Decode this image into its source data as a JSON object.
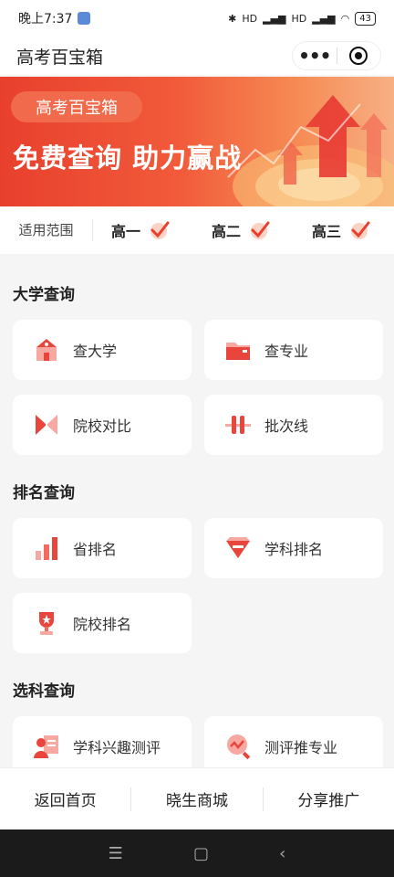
{
  "status": {
    "time": "晚上7:37",
    "battery": "43",
    "net1": "HD",
    "net2": "HD"
  },
  "nav": {
    "title": "高考百宝箱"
  },
  "banner": {
    "tag": "高考百宝箱",
    "headline": "免费查询 助力赢战"
  },
  "scope": {
    "label": "适用范围",
    "grades": [
      "高一",
      "高二",
      "高三"
    ]
  },
  "sections": {
    "university": {
      "title": "大学查询",
      "items": [
        "查大学",
        "查专业",
        "院校对比",
        "批次线"
      ]
    },
    "ranking": {
      "title": "排名查询",
      "items": [
        "省排名",
        "学科排名",
        "院校排名"
      ]
    },
    "subject": {
      "title": "选科查询",
      "items": [
        "学科兴趣测评",
        "测评推专业"
      ]
    }
  },
  "bottom": {
    "items": [
      "返回首页",
      "晓生商城",
      "分享推广"
    ]
  },
  "colors": {
    "accent": "#e8402d",
    "icon_red": "#e8453c",
    "icon_light": "#f7a8a0"
  },
  "icons": [
    "school-icon",
    "folder-icon",
    "compare-icon",
    "batch-line-icon",
    "bar-chart-icon",
    "gem-rank-icon",
    "trophy-icon",
    "person-board-icon",
    "search-chart-icon"
  ]
}
